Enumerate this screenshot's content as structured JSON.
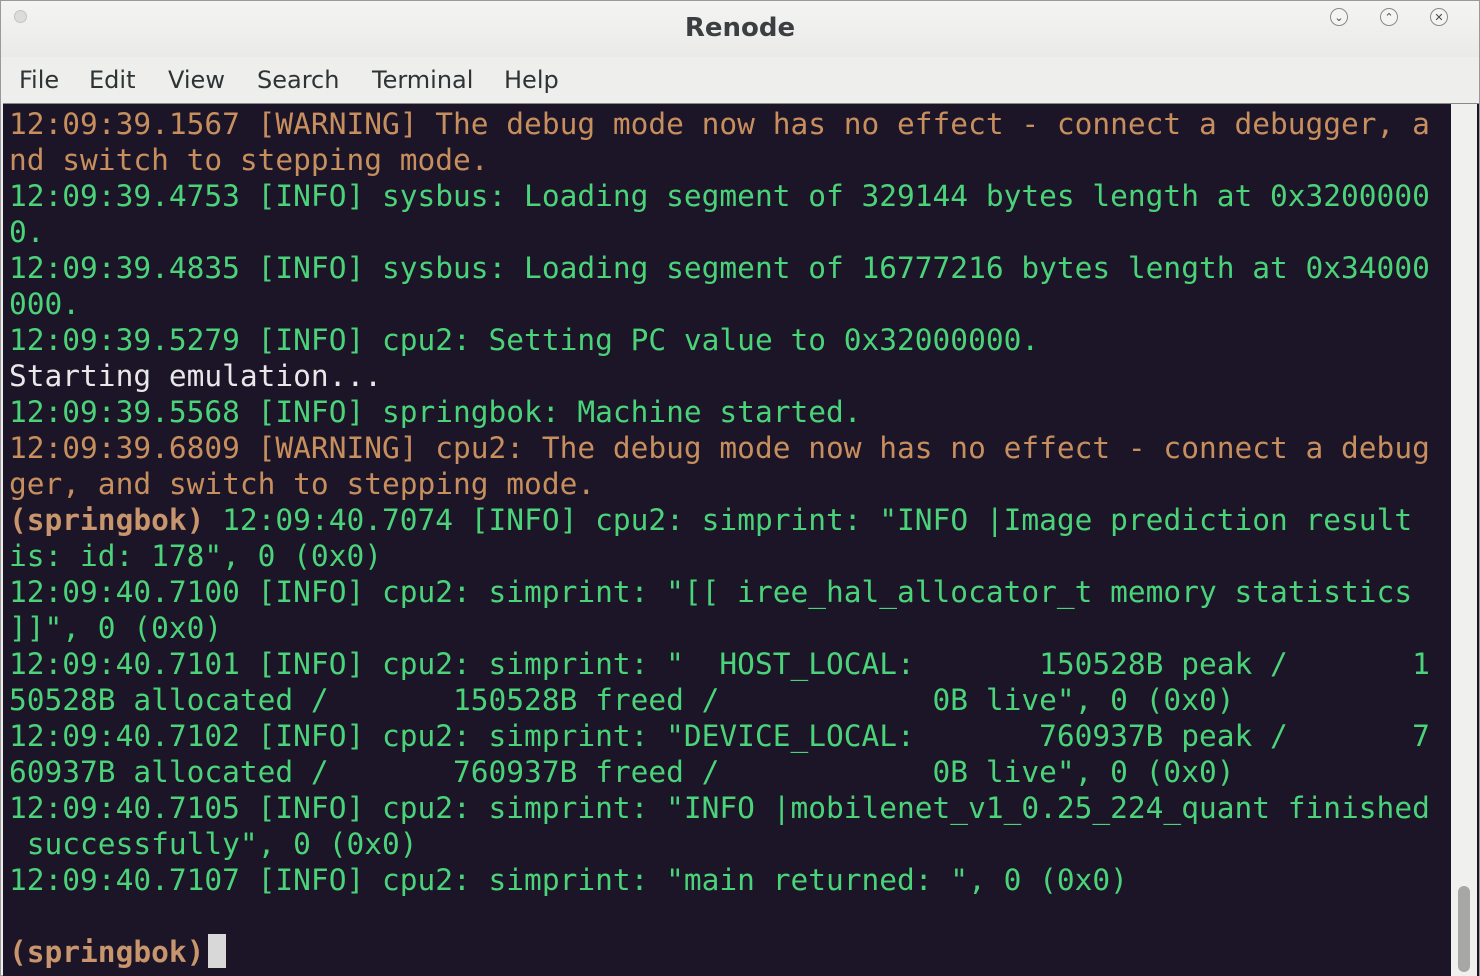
{
  "window": {
    "title": "Renode"
  },
  "menu": [
    "File",
    "Edit",
    "View",
    "Search",
    "Terminal",
    "Help"
  ],
  "colors": {
    "info": "#4bd37a",
    "warning": "#c78e5e",
    "plain": "#e8e8e8",
    "prompt": "#c8956c",
    "background": "#1b1527"
  },
  "terminal": {
    "lines": [
      [
        {
          "t": "12:09:39.1567 [WARNING] The debug mode now has no effect - connect a debugger, a",
          "c": "o"
        }
      ],
      [
        {
          "t": "nd switch to stepping mode.",
          "c": "o"
        }
      ],
      [
        {
          "t": "12:09:39.4753 [INFO] sysbus: Loading segment of 329144 bytes length at 0x3200000",
          "c": "g"
        }
      ],
      [
        {
          "t": "0.",
          "c": "g"
        }
      ],
      [
        {
          "t": "12:09:39.4835 [INFO] sysbus: Loading segment of 16777216 bytes length at 0x34000",
          "c": "g"
        }
      ],
      [
        {
          "t": "000.",
          "c": "g"
        }
      ],
      [
        {
          "t": "12:09:39.5279 [INFO] cpu2: Setting PC value to 0x32000000.",
          "c": "g"
        }
      ],
      [
        {
          "t": "Starting emulation...",
          "c": "w"
        }
      ],
      [
        {
          "t": "12:09:39.5568 [INFO] springbok: Machine started.",
          "c": "g"
        }
      ],
      [
        {
          "t": "12:09:39.6809 [WARNING] cpu2: The debug mode now has no effect - connect a debug",
          "c": "o"
        }
      ],
      [
        {
          "t": "ger, and switch to stepping mode.",
          "c": "o"
        }
      ],
      [
        {
          "t": "(springbok)",
          "c": "p"
        },
        {
          "t": " 12:09:40.7074 [INFO] cpu2: simprint: \"INFO |Image prediction result",
          "c": "g"
        }
      ],
      [
        {
          "t": "is: id: 178\", 0 (0x0)",
          "c": "g"
        }
      ],
      [
        {
          "t": "12:09:40.7100 [INFO] cpu2: simprint: \"[[ iree_hal_allocator_t memory statistics",
          "c": "g"
        }
      ],
      [
        {
          "t": "]]\", 0 (0x0)",
          "c": "g"
        }
      ],
      [
        {
          "t": "12:09:40.7101 [INFO] cpu2: simprint: \"  HOST_LOCAL:       150528B peak /       1",
          "c": "g"
        }
      ],
      [
        {
          "t": "50528B allocated /       150528B freed /            0B live\", 0 (0x0)",
          "c": "g"
        }
      ],
      [
        {
          "t": "12:09:40.7102 [INFO] cpu2: simprint: \"DEVICE_LOCAL:       760937B peak /       7",
          "c": "g"
        }
      ],
      [
        {
          "t": "60937B allocated /       760937B freed /            0B live\", 0 (0x0)",
          "c": "g"
        }
      ],
      [
        {
          "t": "12:09:40.7105 [INFO] cpu2: simprint: \"INFO |mobilenet_v1_0.25_224_quant finished",
          "c": "g"
        }
      ],
      [
        {
          "t": " successfully\", 0 (0x0)",
          "c": "g"
        }
      ],
      [
        {
          "t": "12:09:40.7107 [INFO] cpu2: simprint: \"main returned: \", 0 (0x0)",
          "c": "g"
        }
      ],
      [
        {
          "t": "",
          "c": "w"
        }
      ]
    ],
    "prompt": "(springbok)"
  }
}
